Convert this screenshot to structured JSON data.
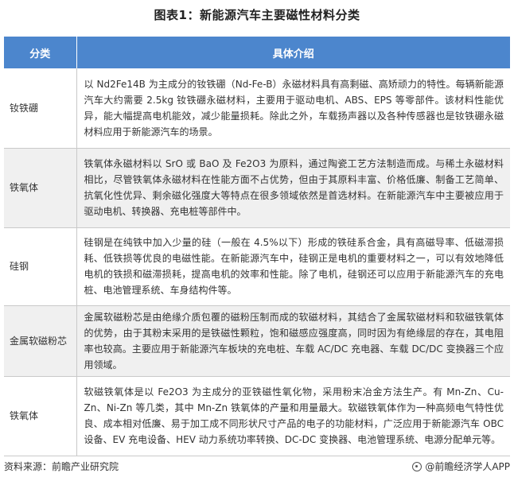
{
  "title": "图表1：新能源汽车主要磁性材料分类",
  "table": {
    "headers": [
      "分类",
      "具体介绍"
    ],
    "rows": [
      {
        "category": "钕铁硼",
        "description": "以 Nd2Fe14B 为主成分的钕铁硼（Nd-Fe-B）永磁材料具有高剩磁、高矫顽力的特性。每辆新能源汽车大约需要 2.5kg 钕铁硼永磁材料，主要用于驱动电机、ABS、EPS 等零部件。该材料性能优异，能大幅提高电机能效，减少能量损耗。除此之外，车载扬声器以及各种传感器也是钕铁硼永磁材料应用于新能源汽车的场景。"
      },
      {
        "category": "铁氧体",
        "description": "铁氧体永磁材料以 SrO 或 BaO 及 Fe2O3 为原料，通过陶瓷工艺方法制造而成。与稀土永磁材料相比，尽管铁氧体永磁材料在性能方面不占优势，但由于其原料丰富、价格低廉、制备工艺简单、抗氧化性优异、剩余磁化强度大等特点在很多领域依然是首选材料。在新能源汽车中主要被应用于驱动电机、转换器、充电桩等部件中。"
      },
      {
        "category": "硅钢",
        "description": "硅钢是在纯铁中加入少量的硅（一般在 4.5%以下）形成的铁硅系合金，具有高磁导率、低磁滞损耗、低铁损等优良的电磁性能。在新能源汽车中，硅钢正是电机的重要材料之一，可以有效地降低电机的铁损和磁滞损耗，提高电机的效率和性能。除了电机，硅钢还可以应用于新能源汽车的充电桩、电池管理系统、车身结构件等。"
      },
      {
        "category": "金属软磁粉芯",
        "description": "金属软磁粉芯是由绝缘介质包覆的磁粉压制而成的软磁材料，其结合了金属软磁材料和软磁铁氧体的优势，由于其粉末采用的是铁磁性颗粒，饱和磁感应强度高，同时因为有绝缘层的存在，其电阻率也较高。主要应用于新能源汽车板块的充电桩、车载 AC/DC 充电器、车载 DC/DC 变换器三个应用领域。"
      },
      {
        "category": "铁氧体",
        "description": "软磁铁氧体是以 Fe2O3 为主成分的亚铁磁性氧化物，采用粉末冶金方法生产。有 Mn-Zn、Cu-Zn、Ni-Zn 等几类，其中 Mn-Zn 铁氧体的产量和用量最大。软磁铁氧体作为一种高频电气特性优良、成本相对低廉、易于加工成不同形状尺寸产品的电子的功能材料，广泛应用于新能源汽车 OBC 设备、EV 充电设备、HEV 动力系统功率转换、DC-DC 变换器、电池管理系统、电源分配单元等。"
      }
    ]
  },
  "footer": {
    "source": "资料来源：前瞻产业研究院",
    "brand": "@前瞻经济学人APP",
    "brand_icon": "eye-logo-icon"
  }
}
